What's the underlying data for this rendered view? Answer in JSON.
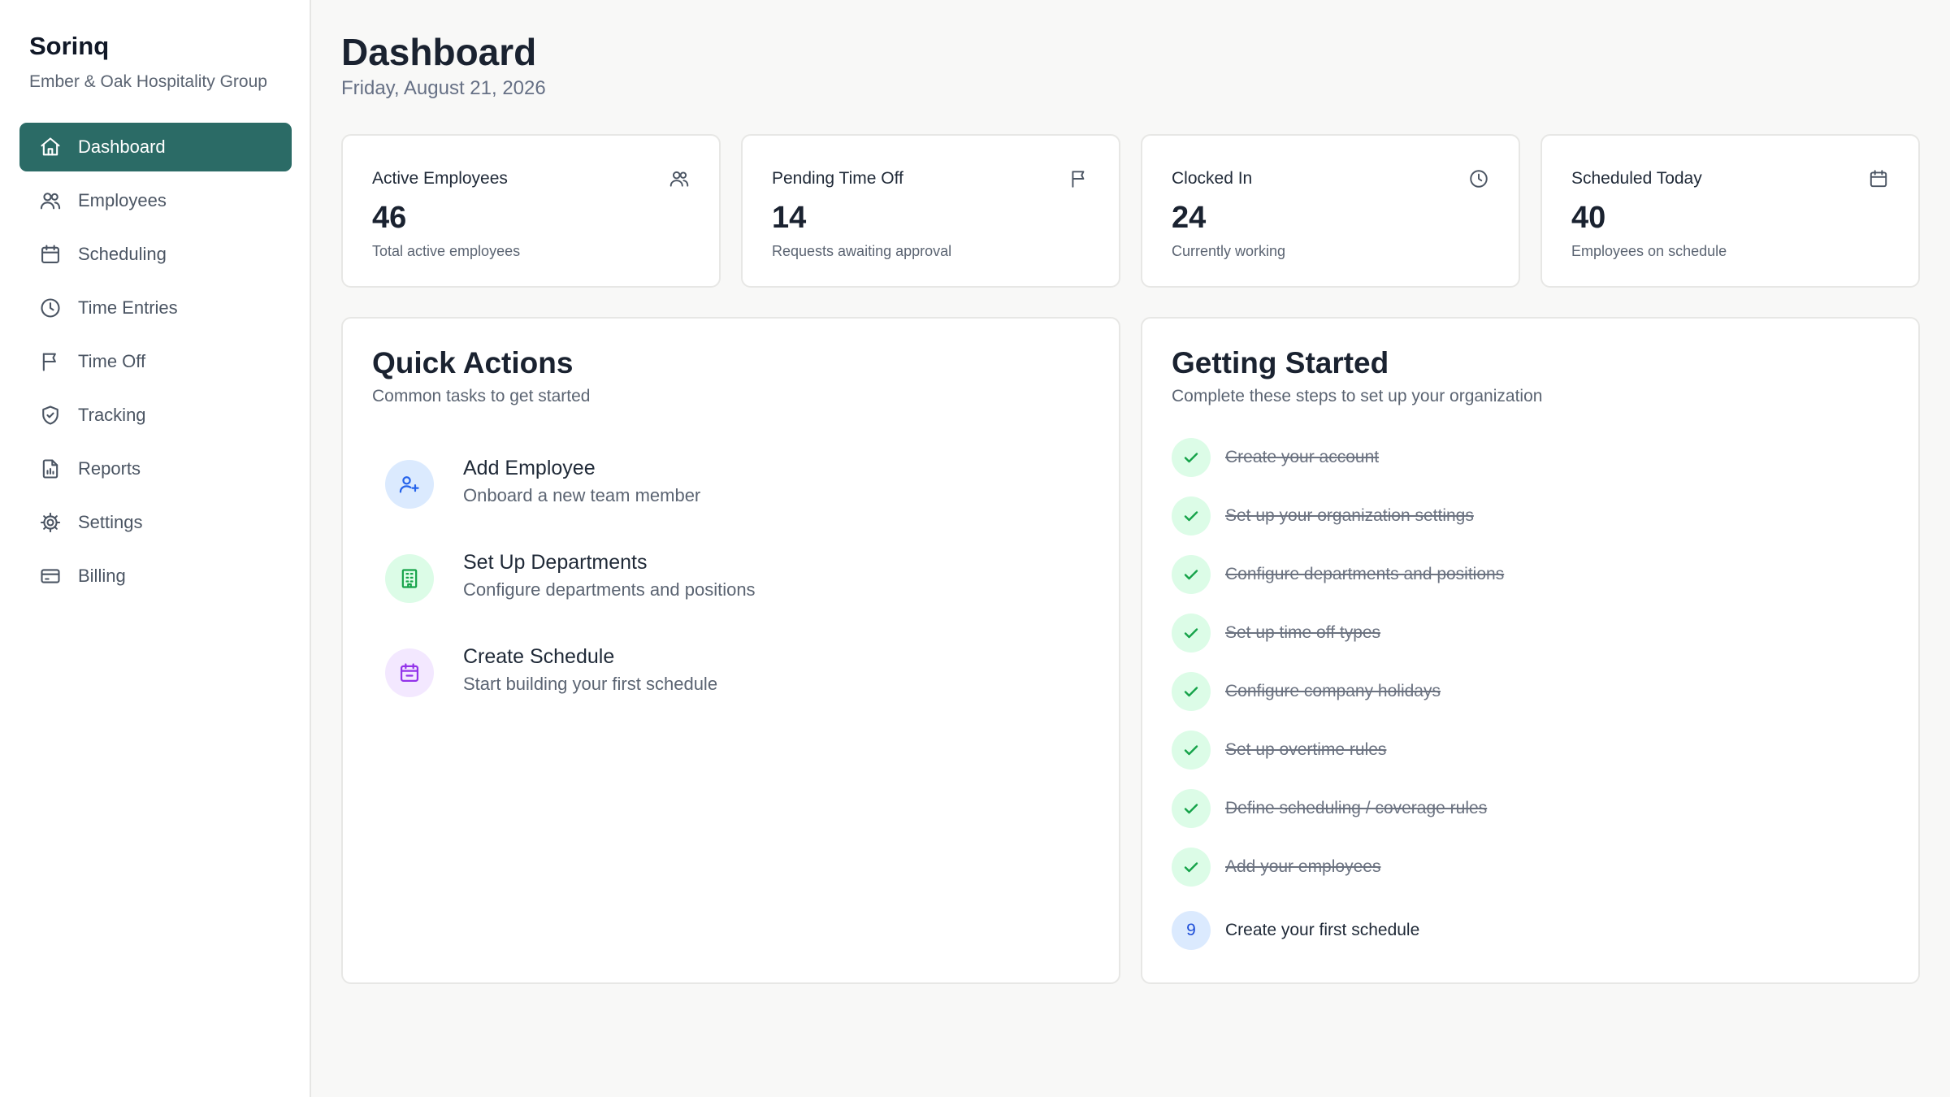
{
  "brand": {
    "name": "Sorinq",
    "organization": "Ember & Oak Hospitality Group"
  },
  "sidebar": {
    "items": [
      {
        "label": "Dashboard",
        "icon": "home-icon",
        "active": true
      },
      {
        "label": "Employees",
        "icon": "users-icon",
        "active": false
      },
      {
        "label": "Scheduling",
        "icon": "calendar-icon",
        "active": false
      },
      {
        "label": "Time Entries",
        "icon": "clock-icon",
        "active": false
      },
      {
        "label": "Time Off",
        "icon": "flag-icon",
        "active": false
      },
      {
        "label": "Tracking",
        "icon": "shield-icon",
        "active": false
      },
      {
        "label": "Reports",
        "icon": "report-icon",
        "active": false
      },
      {
        "label": "Settings",
        "icon": "gear-icon",
        "active": false
      },
      {
        "label": "Billing",
        "icon": "credit-card-icon",
        "active": false
      }
    ]
  },
  "header": {
    "title": "Dashboard",
    "date": "Friday, August 21, 2026"
  },
  "stats": [
    {
      "title": "Active Employees",
      "value": "46",
      "subtitle": "Total active employees",
      "icon": "users-icon"
    },
    {
      "title": "Pending Time Off",
      "value": "14",
      "subtitle": "Requests awaiting approval",
      "icon": "flag-icon"
    },
    {
      "title": "Clocked In",
      "value": "24",
      "subtitle": "Currently working",
      "icon": "clock-icon"
    },
    {
      "title": "Scheduled Today",
      "value": "40",
      "subtitle": "Employees on schedule",
      "icon": "calendar-icon"
    }
  ],
  "quick_actions": {
    "title": "Quick Actions",
    "subtitle": "Common tasks to get started",
    "items": [
      {
        "label": "Add Employee",
        "description": "Onboard a new team member",
        "icon": "user-plus-icon",
        "color": "#2563eb",
        "bg": "#dbeafe"
      },
      {
        "label": "Set Up Departments",
        "description": "Configure departments and positions",
        "icon": "building-icon",
        "color": "#16a34a",
        "bg": "#dcfce7"
      },
      {
        "label": "Create Schedule",
        "description": "Start building your first schedule",
        "icon": "calendar-icon",
        "color": "#9333ea",
        "bg": "#f3e8ff"
      }
    ]
  },
  "getting_started": {
    "title": "Getting Started",
    "subtitle": "Complete these steps to set up your organization",
    "steps": [
      {
        "label": "Create your account",
        "done": true
      },
      {
        "label": "Set up your organization settings",
        "done": true
      },
      {
        "label": "Configure departments and positions",
        "done": true
      },
      {
        "label": "Set up time off types",
        "done": true
      },
      {
        "label": "Configure company holidays",
        "done": true
      },
      {
        "label": "Set up overtime rules",
        "done": true
      },
      {
        "label": "Define scheduling / coverage rules",
        "done": true
      },
      {
        "label": "Add your employees",
        "done": true
      },
      {
        "label": "Create your first schedule",
        "done": false,
        "number": "9"
      }
    ]
  },
  "colors": {
    "accent": "#2b6b66",
    "check": "#16a34a"
  }
}
